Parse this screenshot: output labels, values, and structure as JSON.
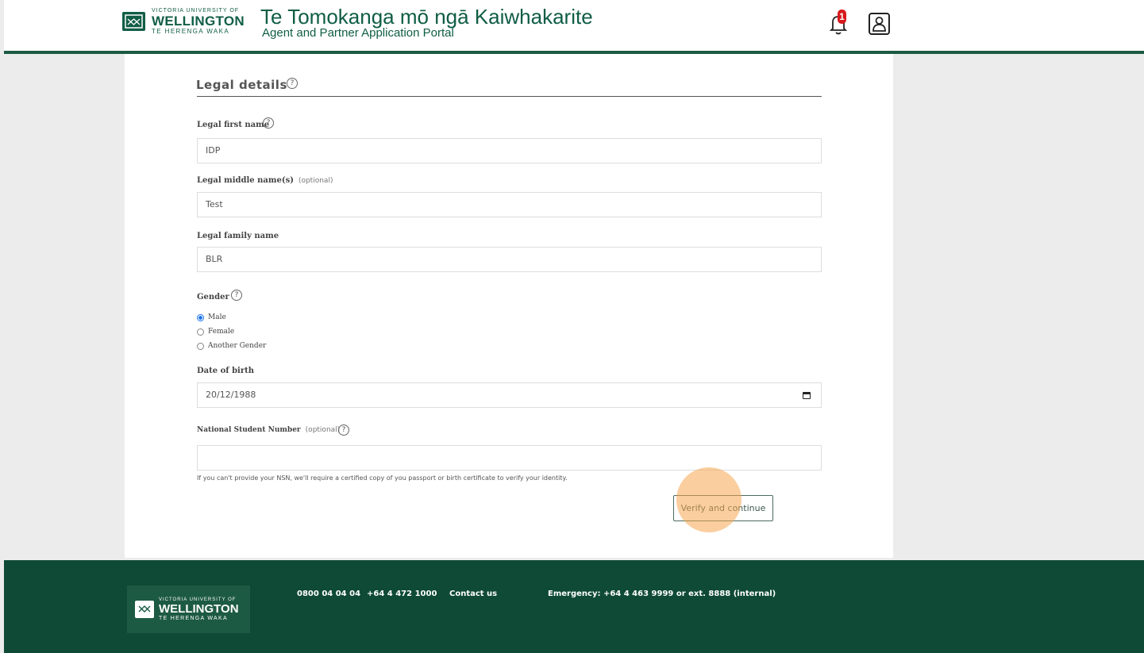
{
  "header": {
    "logo_small": "VICTORIA UNIVERSITY OF",
    "logo_big": "WELLINGTON",
    "logo_sub": "TE HERENGA WAKA",
    "title": "Te Tomokanga mō ngā Kaiwhakarite",
    "subtitle": "Agent and Partner Application Portal",
    "notification_count": "1"
  },
  "form": {
    "section_title": "Legal details",
    "help_glyph": "?",
    "first_name_label": "Legal first name",
    "first_name_value": "IDP",
    "middle_name_label": "Legal middle name(s)",
    "optional": "(optional)",
    "middle_name_value": "Test",
    "family_name_label": "Legal family name",
    "family_name_value": "BLR",
    "gender_label": "Gender",
    "gender_options": [
      "Male",
      "Female",
      "Another Gender"
    ],
    "gender_selected": "Male",
    "dob_label": "Date of birth",
    "dob_value": "20/12/1988",
    "nsn_label": "National Student Number",
    "nsn_value": "",
    "nsn_hint": "If you can't provide your NSN, we'll require a certified copy of you passport or birth certificate to verify your identity.",
    "verify_button": "Verify and continue"
  },
  "footer": {
    "logo_small": "VICTORIA UNIVERSITY OF",
    "logo_big": "WELLINGTON",
    "logo_sub": "TE HERENGA WAKA",
    "phone_free": "0800 04 04 04",
    "phone_intl": "+64 4 472 1000",
    "contact": "Contact us",
    "emergency": "Emergency: +64 4 463 9999 or ext. 8888 (internal)"
  },
  "colors": {
    "brand_green": "#115e46",
    "footer_green": "#0f4a36",
    "badge_red": "#d7191c",
    "radio_blue": "#1a73e8"
  }
}
